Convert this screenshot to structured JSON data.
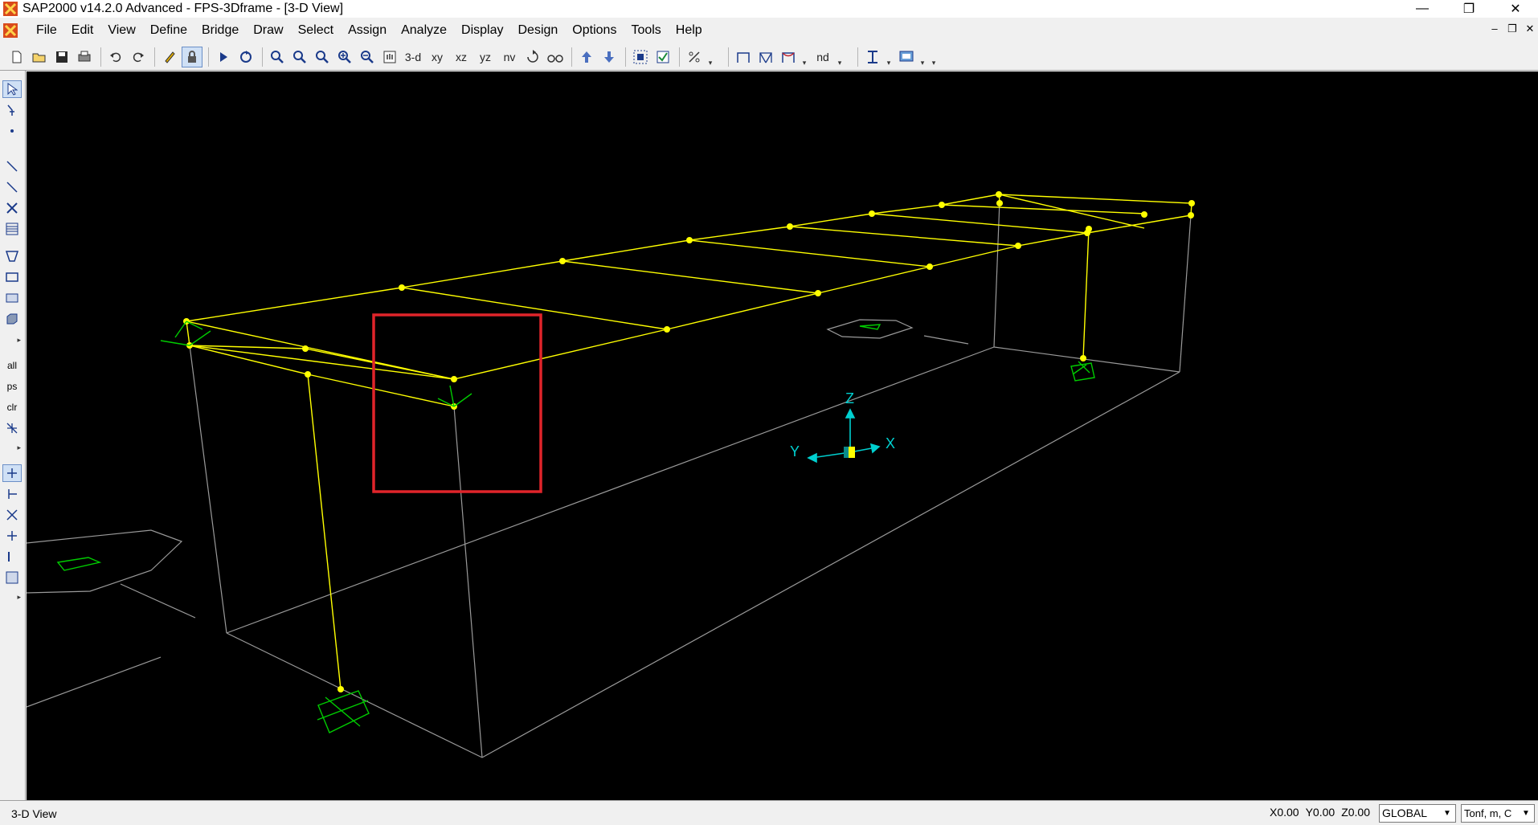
{
  "titlebar": {
    "title": "SAP2000 v14.2.0 Advanced  - FPS-3Dframe - [3-D View]",
    "minimize": "—",
    "restore": "❐",
    "close": "✕"
  },
  "menubar": {
    "items": [
      "File",
      "Edit",
      "View",
      "Define",
      "Bridge",
      "Draw",
      "Select",
      "Assign",
      "Analyze",
      "Display",
      "Design",
      "Options",
      "Tools",
      "Help"
    ],
    "mdi_minimize": "–",
    "mdi_restore": "❐",
    "mdi_close": "✕"
  },
  "toolbar": {
    "view_3d": "3-d",
    "view_xy": "xy",
    "view_xz": "xz",
    "view_yz": "yz",
    "view_nv": "nv",
    "view_nd": "nd"
  },
  "lefttool": {
    "all": "all",
    "ps": "ps",
    "clr": "clr"
  },
  "viewport": {
    "axis_x": "X",
    "axis_y": "Y",
    "axis_z": "Z",
    "frame_color": "#ffff00",
    "support_color": "#00cc00",
    "grid_color": "#9a9a9a",
    "axis_color": "#00d0d0",
    "highlight_color": "#e0242a"
  },
  "statusbar": {
    "view_name": "3-D View",
    "x": "X0.00",
    "y": "Y0.00",
    "z": "Z0.00",
    "coord_system": "GLOBAL",
    "units": "Tonf, m, C"
  }
}
